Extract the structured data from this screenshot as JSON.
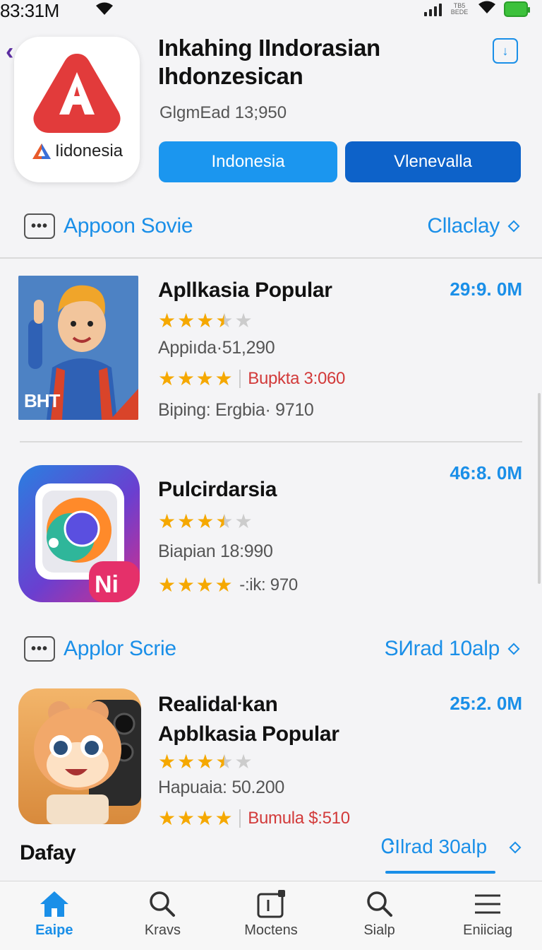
{
  "status_bar": {
    "time": "83:31M",
    "carrier": "TB5 BEDE"
  },
  "header": {
    "title_line1": "Inkahing IIndorasian",
    "title_line2": "Ihdonzesican",
    "subtitle": "GlgmEad 13;950",
    "hero_caption": "Iidonesia",
    "primary_button": "Indonesia",
    "secondary_button": "Vlenevalla"
  },
  "section1": {
    "label": "Appoon Sovie",
    "action": "Cllaclay"
  },
  "items": [
    {
      "title": "Apllkasia Popular",
      "size": "29:9. 0M",
      "rating": 3.5,
      "meta1": "Appiıda·51,290",
      "rating2": 4,
      "meta2": "Bupkta 3:060",
      "meta3": "Biping: Ergbia· 9710",
      "thumb_text": "BHT"
    },
    {
      "title": "Pulcirdarsia",
      "size": "46:8. 0M",
      "rating": 3.5,
      "meta1": "Biapian 18:990",
      "rating2": 4,
      "meta2": "-:ik: 970"
    },
    {
      "title_line1": "Realidaŀkan",
      "title_line2": "Apblkasia Popular",
      "size": "25:2. 0M",
      "rating": 3.5,
      "meta1": "Hapuaia: 50.200",
      "rating2": 4,
      "meta2": "Bumula $:510"
    }
  ],
  "section2": {
    "label": "Applor Scrie",
    "action": "SИrad 10alp"
  },
  "bottom": {
    "label": "Dafay",
    "action": "ᏣIlrad 30alp"
  },
  "tabbar": [
    {
      "label": "Eaipe",
      "icon": "home-icon",
      "active": true
    },
    {
      "label": "Kravs",
      "icon": "search-icon"
    },
    {
      "label": "Moctens",
      "icon": "apps-icon"
    },
    {
      "label": "Sialp",
      "icon": "search-icon"
    },
    {
      "label": "Eniiciag",
      "icon": "menu-icon"
    }
  ],
  "colors": {
    "accent": "#1a8fe8",
    "button_primary": "#1b96ef",
    "button_secondary": "#0d62c9",
    "star": "#f5a800",
    "price_red": "#d23a3a"
  }
}
